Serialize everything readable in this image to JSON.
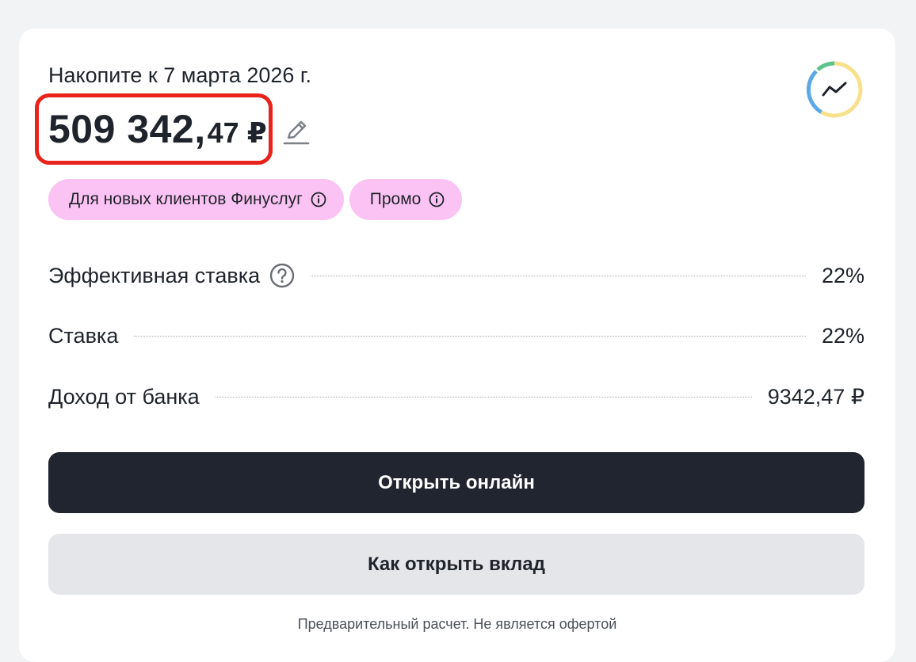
{
  "deposit": {
    "title": "Накопите к 7 марта 2026 г.",
    "amount_main": "509 342,",
    "amount_frac": "47",
    "currency": "₽",
    "edit_icon": "pencil-icon",
    "chart_icon": "trend-chart-icon"
  },
  "tags": [
    {
      "label": "Для новых клиентов Финуслуг",
      "icon": "info-icon"
    },
    {
      "label": "Промо",
      "icon": "info-icon"
    }
  ],
  "rows": [
    {
      "label": "Эффективная ставка",
      "value": "22%",
      "has_help": true
    },
    {
      "label": "Ставка",
      "value": "22%",
      "has_help": false
    },
    {
      "label": "Доход от банка",
      "value": "9342,47 ₽",
      "has_help": false
    }
  ],
  "buttons": {
    "primary": "Открыть онлайн",
    "secondary": "Как открыть вклад"
  },
  "disclaimer": "Предварительный расчет. Не является офертой",
  "colors": {
    "tag_bg": "#fbc3f3",
    "primary_btn": "#212530",
    "secondary_btn": "#e4e6ea",
    "highlight_border": "#e8231b",
    "ring_blue": "#5aa9e6",
    "ring_yellow": "#f7e18c",
    "ring_green": "#5cc38a"
  }
}
